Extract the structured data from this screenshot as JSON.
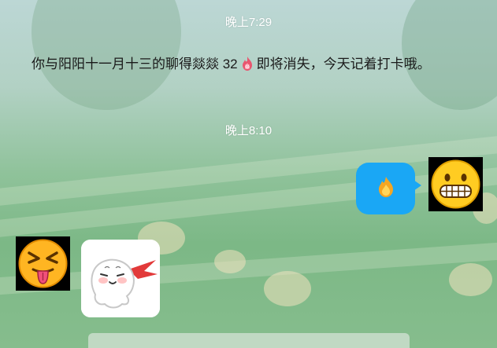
{
  "timestamps": [
    "晚上7:29",
    "晚上8:10"
  ],
  "notice": {
    "before_icon": "你与阳阳十一月十三的聊得燚燚 32",
    "icon": "flame-badge-icon",
    "after_icon": "即将消失，今天记着打卡哦。"
  },
  "messages": [
    {
      "side": "right",
      "type": "emoji-bubble",
      "icon": "fire-icon",
      "bubble_color": "#1aa7f5"
    },
    {
      "side": "left",
      "type": "sticker",
      "icon": "ghost-sticker"
    }
  ],
  "avatars": {
    "self": "grimacing-face-icon",
    "contact": "tongue-out-angry-face-icon"
  },
  "partial_text": ""
}
